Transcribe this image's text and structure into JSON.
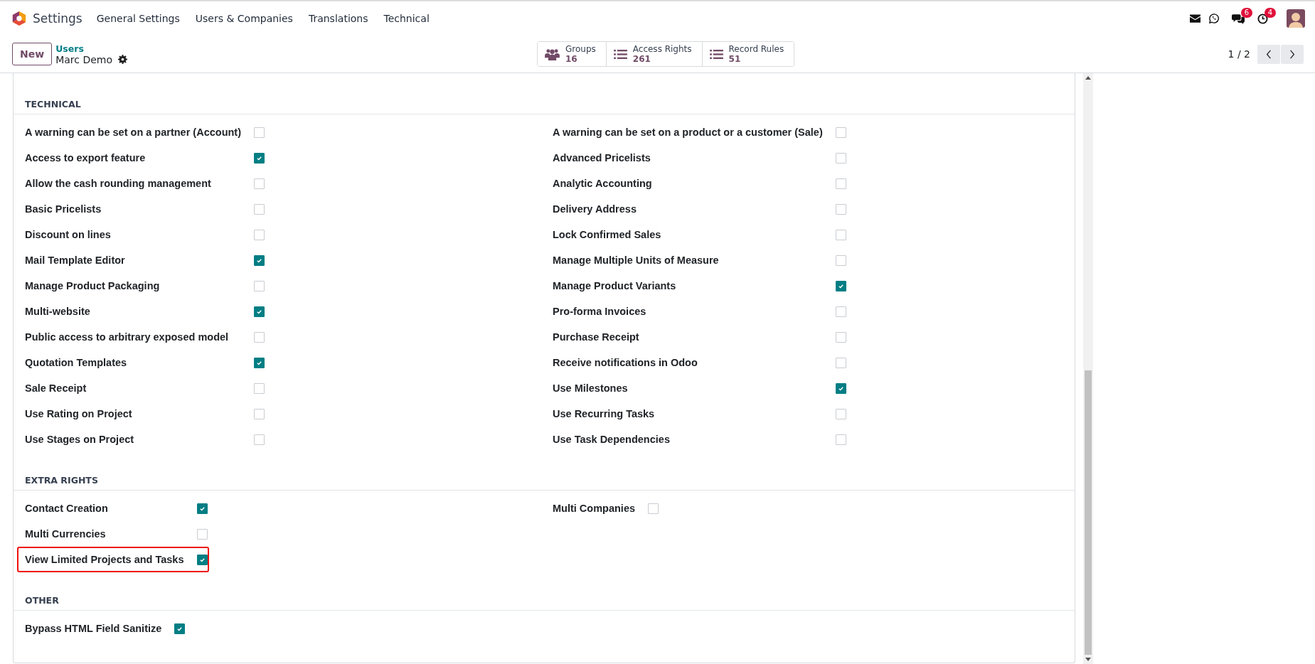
{
  "navbar": {
    "app_name": "Settings",
    "menu": [
      "General Settings",
      "Users & Companies",
      "Translations",
      "Technical"
    ],
    "systray": [
      {
        "kind": "mail"
      },
      {
        "kind": "whatsapp"
      },
      {
        "kind": "chat",
        "badge": "6"
      },
      {
        "kind": "activity",
        "badge": "4"
      },
      {
        "kind": "avatar"
      }
    ]
  },
  "control_panel": {
    "new_button": "New",
    "breadcrumb": "Users",
    "record_name": "Marc Demo",
    "stat_buttons": [
      {
        "kind": "groups",
        "label": "Groups",
        "value": "16"
      },
      {
        "kind": "list",
        "label": "Access Rights",
        "value": "261"
      },
      {
        "kind": "list",
        "label": "Record Rules",
        "value": "51"
      }
    ],
    "pager": "1 / 2"
  },
  "sections": [
    {
      "title": "TECHNICAL",
      "columns": [
        [
          {
            "label": "A warning can be set on a partner (Account)",
            "checked": false,
            "highlighted": false
          },
          {
            "label": "Access to export feature",
            "checked": true,
            "highlighted": false
          },
          {
            "label": "Allow the cash rounding management",
            "checked": false,
            "highlighted": false
          },
          {
            "label": "Basic Pricelists",
            "checked": false,
            "highlighted": false
          },
          {
            "label": "Discount on lines",
            "checked": false,
            "highlighted": false
          },
          {
            "label": "Mail Template Editor",
            "checked": true,
            "highlighted": false
          },
          {
            "label": "Manage Product Packaging",
            "checked": false,
            "highlighted": false
          },
          {
            "label": "Multi-website",
            "checked": true,
            "highlighted": false
          },
          {
            "label": "Public access to arbitrary exposed model",
            "checked": false,
            "highlighted": false
          },
          {
            "label": "Quotation Templates",
            "checked": true,
            "highlighted": false
          },
          {
            "label": "Sale Receipt",
            "checked": false,
            "highlighted": false
          },
          {
            "label": "Use Rating on Project",
            "checked": false,
            "highlighted": false
          },
          {
            "label": "Use Stages on Project",
            "checked": false,
            "highlighted": false
          }
        ],
        [
          {
            "label": "A warning can be set on a product or a customer (Sale)",
            "checked": false,
            "highlighted": false
          },
          {
            "label": "Advanced Pricelists",
            "checked": false,
            "highlighted": false
          },
          {
            "label": "Analytic Accounting",
            "checked": false,
            "highlighted": false
          },
          {
            "label": "Delivery Address",
            "checked": false,
            "highlighted": false
          },
          {
            "label": "Lock Confirmed Sales",
            "checked": false,
            "highlighted": false
          },
          {
            "label": "Manage Multiple Units of Measure",
            "checked": false,
            "highlighted": false
          },
          {
            "label": "Manage Product Variants",
            "checked": true,
            "highlighted": false
          },
          {
            "label": "Pro-forma Invoices",
            "checked": false,
            "highlighted": false
          },
          {
            "label": "Purchase Receipt",
            "checked": false,
            "highlighted": false
          },
          {
            "label": "Receive notifications in Odoo",
            "checked": false,
            "highlighted": false
          },
          {
            "label": "Use Milestones",
            "checked": true,
            "highlighted": false
          },
          {
            "label": "Use Recurring Tasks",
            "checked": false,
            "highlighted": false
          },
          {
            "label": "Use Task Dependencies",
            "checked": false,
            "highlighted": false
          }
        ]
      ]
    },
    {
      "title": "EXTRA RIGHTS",
      "columns": [
        [
          {
            "label": "Contact Creation",
            "checked": true,
            "highlighted": false
          },
          {
            "label": "Multi Currencies",
            "checked": false,
            "highlighted": false
          },
          {
            "label": "View Limited Projects and Tasks",
            "checked": true,
            "highlighted": true
          }
        ],
        [
          {
            "label": "Multi Companies",
            "checked": false,
            "highlighted": false
          }
        ]
      ]
    },
    {
      "title": "OTHER",
      "columns": [
        [
          {
            "label": "Bypass HTML Field Sanitize",
            "checked": true,
            "highlighted": false
          }
        ]
      ]
    }
  ]
}
